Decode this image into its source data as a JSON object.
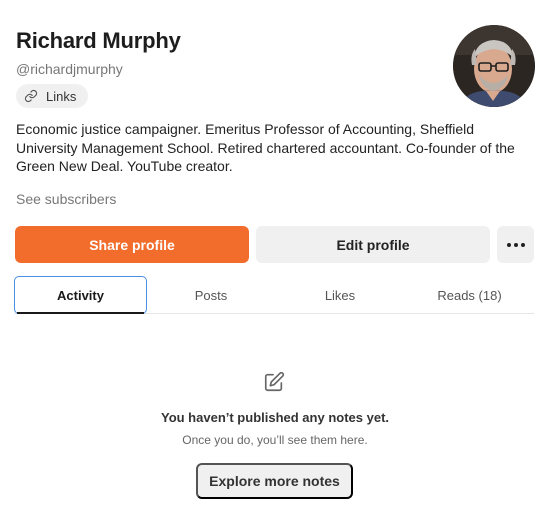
{
  "profile": {
    "name": "Richard Murphy",
    "handle": "@richardjmurphy",
    "links_label": "Links",
    "bio": "Economic justice campaigner. Emeritus Professor of Accounting, Sheffield University Management School. Retired chartered accountant. Co-founder of the Green New Deal. YouTube creator.",
    "subscribers_label": "See subscribers"
  },
  "actions": {
    "share_label": "Share profile",
    "edit_label": "Edit profile",
    "more_icon": "more-dots-icon"
  },
  "tabs": [
    {
      "label": "Activity",
      "active": true
    },
    {
      "label": "Posts",
      "active": false
    },
    {
      "label": "Likes",
      "active": false
    },
    {
      "label": "Reads (18)",
      "active": false
    }
  ],
  "empty_state": {
    "icon": "edit-note-icon",
    "title": "You haven’t published any notes yet.",
    "subtitle": "Once you do, you’ll see them here.",
    "button_label": "Explore more notes"
  },
  "colors": {
    "accent": "#f26c2b",
    "focus_outline": "#4a90e2",
    "chip_bg": "#f0f0f0"
  }
}
